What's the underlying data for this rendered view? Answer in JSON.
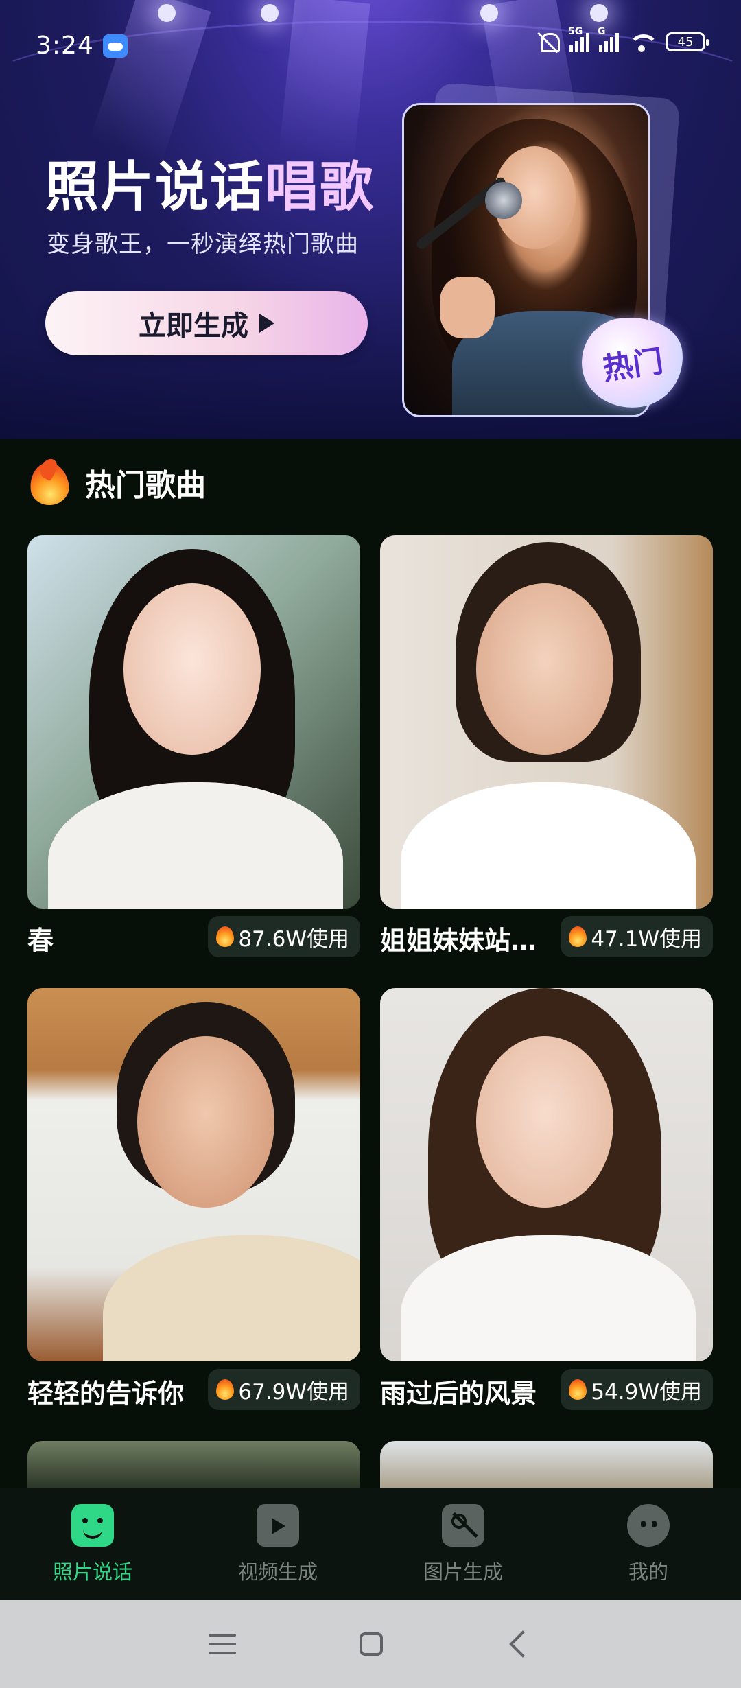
{
  "status_bar": {
    "time": "3:24",
    "signal1_label": "5G",
    "signal2_label": "G",
    "battery": "45"
  },
  "hero": {
    "title_part1": "照片说话",
    "title_part2": "唱歌",
    "subtitle": "变身歌王，一秒演绎热门歌曲",
    "cta_label": "立即生成",
    "badge": "热门"
  },
  "hot_songs": {
    "title": "热门歌曲",
    "items": [
      {
        "name": "春",
        "usage": "87.6W使用"
      },
      {
        "name": "姐姐妹妹站…",
        "usage": "47.1W使用"
      },
      {
        "name": "轻轻的告诉你",
        "usage": "67.9W使用"
      },
      {
        "name": "雨过后的风景",
        "usage": "54.9W使用"
      }
    ]
  },
  "tabs": [
    {
      "label": "照片说话",
      "icon": "photo-talk-icon",
      "active": true
    },
    {
      "label": "视频生成",
      "icon": "video-gen-icon",
      "active": false
    },
    {
      "label": "图片生成",
      "icon": "image-gen-icon",
      "active": false
    },
    {
      "label": "我的",
      "icon": "mine-icon",
      "active": false
    }
  ],
  "colors": {
    "accent": "#2fd887",
    "background": "#071008",
    "hero_title_highlight": "#f3c8ff",
    "badge_text": "#5a2fd0"
  }
}
